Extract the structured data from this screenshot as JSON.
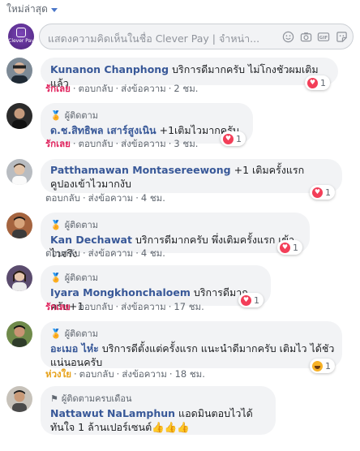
{
  "sort_label": "ใหม่ล่าสุด",
  "composer": {
    "logo_text": "Clever Pay",
    "placeholder": "แสดงความคิดเห็นในชื่อ Clever Pay | จำหน่า..."
  },
  "comments": [
    {
      "badge": "",
      "name": "Kunanon Chanphong",
      "text": "บริการดีมากครับ ไม่โกงชัวผมเติมแล้ว",
      "action_primary": "รักเลย",
      "reply": "ตอบกลับ",
      "message": "ส่งข้อความ",
      "time": "2 ชม.",
      "reaction_icon": "heart-icon",
      "reaction_count": "1"
    },
    {
      "badge": "ผู้ติดตาม",
      "name": "ด.ช.สิทธิพล เสาร์สูงเนิน",
      "text": "+1เติมไวมากครับ",
      "action_primary": "รักเลย",
      "reply": "ตอบกลับ",
      "message": "ส่งข้อความ",
      "time": "3 ชม.",
      "reaction_icon": "heart-icon",
      "reaction_count": "1"
    },
    {
      "badge": "",
      "name": "Patthamawan Montasereewong",
      "text": "+1 เติมครั้งแรก คูปองเข้าไวมากงับ",
      "action_primary": "",
      "reply": "ตอบกลับ",
      "message": "ส่งข้อความ",
      "time": "4 ชม.",
      "reaction_icon": "heart-icon",
      "reaction_count": "1"
    },
    {
      "badge": "ผู้ติดตาม",
      "name": "Kan Dechawat",
      "text": "บริการดีมากครับ พึ่งเติมครั้งแรก เข้าไวจริง",
      "action_primary": "",
      "reply": "ตอบกลับ",
      "message": "ส่งข้อความ",
      "time": "4 ชม.",
      "reaction_icon": "heart-icon",
      "reaction_count": "1"
    },
    {
      "badge": "ผู้ติดตาม",
      "name": "Iyara Mongkhonchaloem",
      "text": "บริการดีมากครับ+1",
      "action_primary": "รักเลย",
      "reply": "ตอบกลับ",
      "message": "ส่งข้อความ",
      "time": "17 ชม.",
      "reaction_icon": "heart-icon",
      "reaction_count": "1"
    },
    {
      "badge": "ผู้ติดตาม",
      "name": "อะเมอ ไห๋ะ",
      "text": "บริการดีตั้งแต่ครั้งแรก แนะนำดีมากครับ เติมไว ได้ชัวแน่นอนครับ",
      "action_primary": "ห่วงใย",
      "reply": "ตอบกลับ",
      "message": "ส่งข้อความ",
      "time": "18 ชม.",
      "reaction_icon": "haha-icon",
      "reaction_count": "1"
    },
    {
      "badge": "ผู้ติดตามครบเดือน",
      "name": "Nattawut NaLamphun",
      "text": "แอดมินตอบไวได้ทันใจ 1 ล้านเปอร์เซนต์👍👍👍",
      "action_primary": "",
      "reply": "ตอบกลับ",
      "message": "ส่งข้อความ",
      "time": "18 ชม.",
      "reaction_icon": "",
      "reaction_count": ""
    }
  ],
  "colors": {
    "name": "#385898",
    "love": "#e0245e",
    "care": "#e6a119",
    "bubble": "#f2f3f5"
  }
}
